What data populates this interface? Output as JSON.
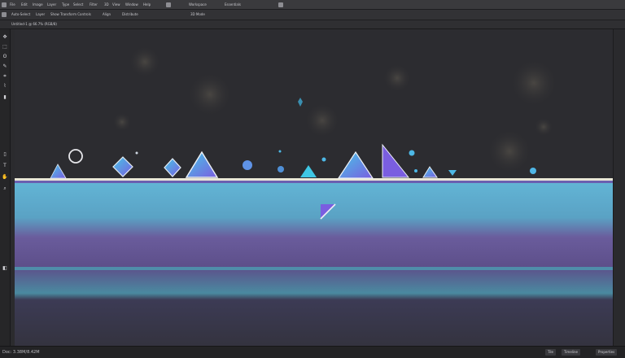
{
  "menubar": {
    "items": [
      "File",
      "Edit",
      "Image",
      "Layer",
      "Type",
      "Select",
      "Filter",
      "3D",
      "View",
      "Window",
      "Help",
      "Workspace",
      "Essentials"
    ]
  },
  "toolbar": {
    "items": [
      "Auto-Select",
      "Layer",
      "Show Transform Controls",
      "Align",
      "Distribute",
      "3D Mode"
    ]
  },
  "optionsbar": {
    "document_tab": "Untitled-1 @ 66.7% (RGB/8)"
  },
  "tools": [
    "move-tool",
    "marquee-tool",
    "lasso-tool",
    "quick-select-tool",
    "crop-tool",
    "eyedropper-tool",
    "brush-tool",
    "eraser-tool",
    "text-tool",
    "hand-tool",
    "zoom-tool"
  ],
  "status": {
    "doc_info": "Doc: 3.38M/8.42M",
    "zoom": "66.67%",
    "btn_a": "Tile",
    "btn_b": "Timeline",
    "btn_c": "Properties"
  },
  "colors": {
    "accent_cyan": "#4fc3dc",
    "accent_purple": "#7a5ee0",
    "band_top": "#5aa6c8",
    "band_mid": "#5e4f8c",
    "band_bottom": "#3d3c58",
    "horizon": "#e9e6d6"
  }
}
